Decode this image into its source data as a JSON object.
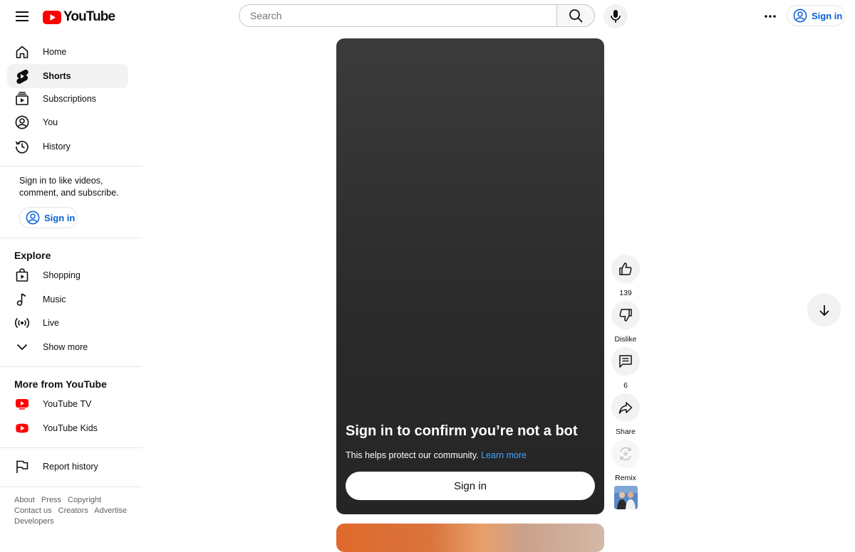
{
  "header": {
    "logo_text": "YouTube",
    "search_placeholder": "Search",
    "signin_label": "Sign in"
  },
  "sidebar": {
    "main_items": [
      {
        "label": "Home",
        "icon": "home-icon"
      },
      {
        "label": "Shorts",
        "icon": "shorts-icon",
        "active": true
      },
      {
        "label": "Subscriptions",
        "icon": "subscriptions-icon"
      },
      {
        "label": "You",
        "icon": "user-circle-icon"
      },
      {
        "label": "History",
        "icon": "history-icon"
      }
    ],
    "signin_prompt": "Sign in to like videos, comment, and subscribe.",
    "signin_label": "Sign in",
    "explore_heading": "Explore",
    "explore_items": [
      {
        "label": "Shopping",
        "icon": "shopping-bag-icon"
      },
      {
        "label": "Music",
        "icon": "music-note-icon"
      },
      {
        "label": "Live",
        "icon": "live-icon"
      },
      {
        "label": "Show more",
        "icon": "chevron-down-icon"
      }
    ],
    "more_heading": "More from YouTube",
    "more_items": [
      {
        "label": "YouTube TV",
        "icon": "youtube-tv-icon"
      },
      {
        "label": "YouTube Kids",
        "icon": "youtube-kids-icon"
      }
    ],
    "report_history": "Report history",
    "footer_links_row1": [
      "About",
      "Press",
      "Copyright"
    ],
    "footer_links_row2": [
      "Contact us",
      "Creators",
      "Advertise"
    ],
    "footer_links_row3": [
      "Developers"
    ]
  },
  "short": {
    "title": "Sign in to confirm you’re not a bot",
    "subtitle": "This helps protect our community.",
    "learn_more": "Learn more",
    "signin_button": "Sign in"
  },
  "actions": {
    "like_count": "139",
    "dislike_label": "Dislike",
    "comment_count": "6",
    "share_label": "Share",
    "remix_label": "Remix"
  },
  "colors": {
    "brand_red": "#ff0000",
    "link_blue": "#065fd4",
    "player_bg": "#2b2b2b"
  }
}
